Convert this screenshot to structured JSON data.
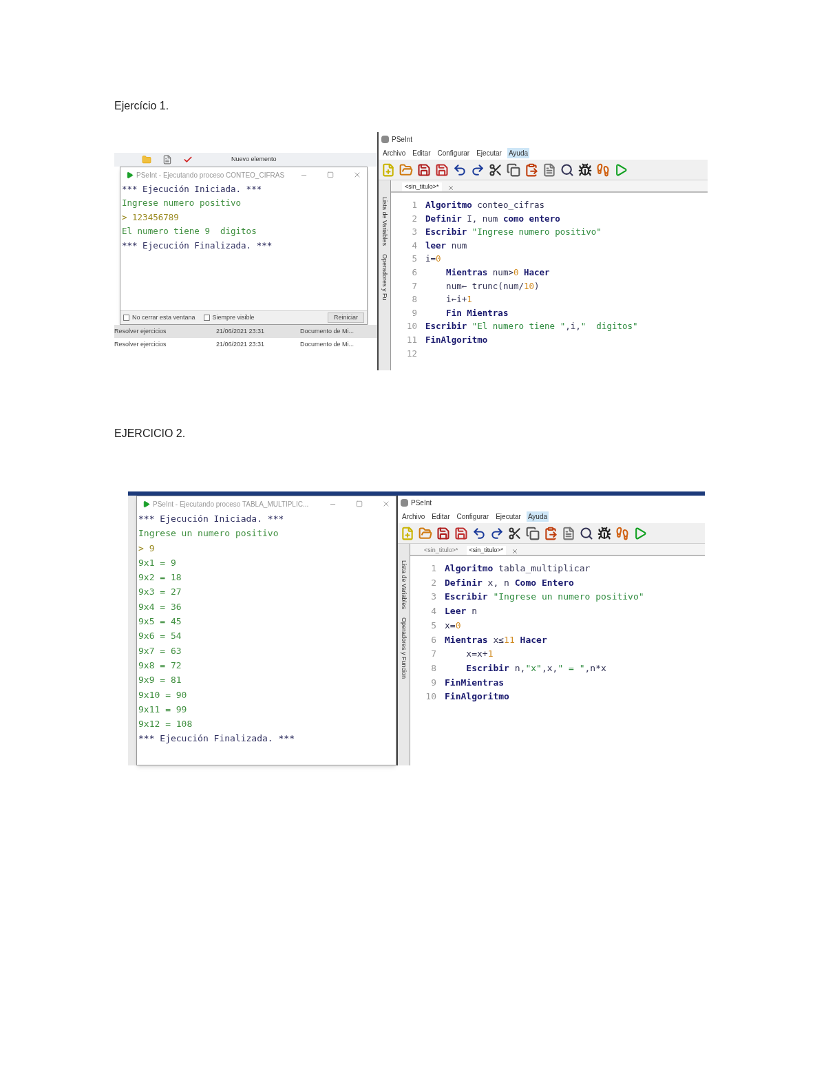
{
  "sections": [
    {
      "heading": "Ejercício 1.",
      "explorer": {
        "new_item": "Nuevo elemento",
        "files": [
          {
            "name": "Resolver ejercicios",
            "date": "21/06/2021 23:31",
            "type": "Documento de Mi...",
            "selected": true
          },
          {
            "name": "Resolver ejercicios",
            "date": "21/06/2021 23:31",
            "type": "Documento de Mi...",
            "selected": false
          }
        ]
      },
      "console": {
        "title": "PSeInt - Ejecutando proceso CONTEO_CIFRAS",
        "lines": [
          {
            "text": "*** Ejecución Iniciada. ***",
            "kind": "status"
          },
          {
            "text": "Ingrese numero positivo",
            "kind": "output"
          },
          {
            "text": "> 123456789",
            "kind": "input"
          },
          {
            "text": "El numero tiene 9  digitos",
            "kind": "output"
          },
          {
            "text": "*** Ejecución Finalizada. ***",
            "kind": "status"
          }
        ],
        "footer": {
          "options": [
            {
              "label": "No cerrar esta ventana",
              "checked": false
            },
            {
              "label": "Siempre visible",
              "checked": false
            }
          ],
          "button": "Reiniciar"
        }
      },
      "editor": {
        "title": "PSeInt",
        "menu": [
          {
            "label": "Archivo",
            "selected": false
          },
          {
            "label": "Editar",
            "selected": false
          },
          {
            "label": "Configurar",
            "selected": false
          },
          {
            "label": "Ejecutar",
            "selected": false
          },
          {
            "label": "Ayuda",
            "selected": true
          }
        ],
        "tabs": [
          {
            "label": "<sin_titulo>*",
            "selected": true
          }
        ],
        "side_panels": [
          "Lista de Variables",
          "Operadores y Fu"
        ],
        "lines": [
          {
            "number": "1",
            "parts": [
              {
                "text": "Algoritmo",
                "kind": "keyword"
              },
              {
                "text": " conteo_cifras",
                "kind": "plain"
              }
            ]
          },
          {
            "number": "2",
            "parts": [
              {
                "text": "Definir",
                "kind": "keyword"
              },
              {
                "text": " I, num ",
                "kind": "plain"
              },
              {
                "text": "como entero",
                "kind": "keyword"
              }
            ]
          },
          {
            "number": "3",
            "parts": [
              {
                "text": "Escribir ",
                "kind": "keyword"
              },
              {
                "text": "\"Ingrese numero positivo\"",
                "kind": "string"
              }
            ]
          },
          {
            "number": "4",
            "parts": [
              {
                "text": "leer",
                "kind": "keyword"
              },
              {
                "text": " num",
                "kind": "plain"
              }
            ]
          },
          {
            "number": "5",
            "parts": [
              {
                "text": "i=",
                "kind": "plain"
              },
              {
                "text": "0",
                "kind": "number"
              }
            ]
          },
          {
            "number": "6",
            "parts": [
              {
                "text": "    Mientras",
                "kind": "keyword"
              },
              {
                "text": " num>",
                "kind": "plain"
              },
              {
                "text": "0",
                "kind": "number"
              },
              {
                "text": " Hacer",
                "kind": "keyword"
              }
            ]
          },
          {
            "number": "7",
            "parts": [
              {
                "text": "    num← trunc(num/",
                "kind": "plain"
              },
              {
                "text": "10",
                "kind": "number"
              },
              {
                "text": ")",
                "kind": "plain"
              }
            ]
          },
          {
            "number": "8",
            "parts": [
              {
                "text": "    i←i+",
                "kind": "plain"
              },
              {
                "text": "1",
                "kind": "number"
              }
            ]
          },
          {
            "number": "9",
            "parts": [
              {
                "text": "    Fin Mientras",
                "kind": "keyword"
              }
            ]
          },
          {
            "number": "10",
            "parts": [
              {
                "text": "Escribir ",
                "kind": "keyword"
              },
              {
                "text": "\"El numero tiene \"",
                "kind": "string"
              },
              {
                "text": ",i,",
                "kind": "plain"
              },
              {
                "text": "\"  digitos\"",
                "kind": "string"
              }
            ]
          },
          {
            "number": "11",
            "parts": [
              {
                "text": "FinAlgoritmo",
                "kind": "keyword"
              }
            ]
          },
          {
            "number": "12"
          }
        ]
      }
    },
    {
      "heading": "EJERCICIO 2.",
      "console": {
        "title": "PSeInt - Ejecutando proceso TABLA_MULTIPLIC...",
        "lines": [
          {
            "text": "*** Ejecución Iniciada. ***",
            "kind": "status"
          },
          {
            "text": "Ingrese un numero positivo",
            "kind": "output"
          },
          {
            "text": "> 9",
            "kind": "input"
          },
          {
            "text": "9x1 = 9",
            "kind": "output"
          },
          {
            "text": "9x2 = 18",
            "kind": "output"
          },
          {
            "text": "9x3 = 27",
            "kind": "output"
          },
          {
            "text": "9x4 = 36",
            "kind": "output"
          },
          {
            "text": "9x5 = 45",
            "kind": "output"
          },
          {
            "text": "9x6 = 54",
            "kind": "output"
          },
          {
            "text": "9x7 = 63",
            "kind": "output"
          },
          {
            "text": "9x8 = 72",
            "kind": "output"
          },
          {
            "text": "9x9 = 81",
            "kind": "output"
          },
          {
            "text": "9x10 = 90",
            "kind": "output"
          },
          {
            "text": "9x11 = 99",
            "kind": "output"
          },
          {
            "text": "9x12 = 108",
            "kind": "output"
          },
          {
            "text": "*** Ejecución Finalizada. ***",
            "kind": "status"
          }
        ]
      },
      "editor": {
        "title": "PSeInt",
        "menu": [
          {
            "label": "Archivo",
            "selected": false
          },
          {
            "label": "Editar",
            "selected": false
          },
          {
            "label": "Configurar",
            "selected": false
          },
          {
            "label": "Ejecutar",
            "selected": false
          },
          {
            "label": "Ayuda",
            "selected": true
          }
        ],
        "tabs": [
          {
            "label": "<sin_titulo>*",
            "selected": false
          },
          {
            "label": "<sin_titulo>*",
            "selected": true
          }
        ],
        "side_panels": [
          "Lista de Variables",
          "Operadores y Funcion"
        ],
        "lines": [
          {
            "number": "1",
            "parts": [
              {
                "text": "Algoritmo",
                "kind": "keyword"
              },
              {
                "text": " tabla_multiplicar",
                "kind": "plain"
              }
            ]
          },
          {
            "number": "2",
            "parts": [
              {
                "text": "Definir",
                "kind": "keyword"
              },
              {
                "text": " x, n ",
                "kind": "plain"
              },
              {
                "text": "Como Entero",
                "kind": "keyword"
              }
            ]
          },
          {
            "number": "3",
            "parts": [
              {
                "text": "Escribir ",
                "kind": "keyword"
              },
              {
                "text": "\"Ingrese un numero positivo\"",
                "kind": "string"
              }
            ]
          },
          {
            "number": "4",
            "parts": [
              {
                "text": "Leer",
                "kind": "keyword"
              },
              {
                "text": " n",
                "kind": "plain"
              }
            ]
          },
          {
            "number": "5",
            "parts": [
              {
                "text": "x=",
                "kind": "plain"
              },
              {
                "text": "0",
                "kind": "number"
              }
            ]
          },
          {
            "number": "6",
            "parts": [
              {
                "text": "Mientras",
                "kind": "keyword"
              },
              {
                "text": " x≤",
                "kind": "plain"
              },
              {
                "text": "11",
                "kind": "number"
              },
              {
                "text": " Hacer",
                "kind": "keyword"
              }
            ]
          },
          {
            "number": "7",
            "parts": [
              {
                "text": "    x=x+",
                "kind": "plain"
              },
              {
                "text": "1",
                "kind": "number"
              }
            ]
          },
          {
            "number": "8",
            "parts": [
              {
                "text": "    Escribir",
                "kind": "keyword"
              },
              {
                "text": " n,",
                "kind": "plain"
              },
              {
                "text": "\"x\"",
                "kind": "string"
              },
              {
                "text": ",x,",
                "kind": "plain"
              },
              {
                "text": "\" = \"",
                "kind": "string"
              },
              {
                "text": ",n*x",
                "kind": "plain"
              }
            ]
          },
          {
            "number": "9",
            "parts": [
              {
                "text": "FinMientras",
                "kind": "keyword"
              }
            ]
          },
          {
            "number": "10",
            "parts": [
              {
                "text": "FinAlgoritmo",
                "kind": "keyword"
              }
            ]
          }
        ]
      }
    }
  ]
}
